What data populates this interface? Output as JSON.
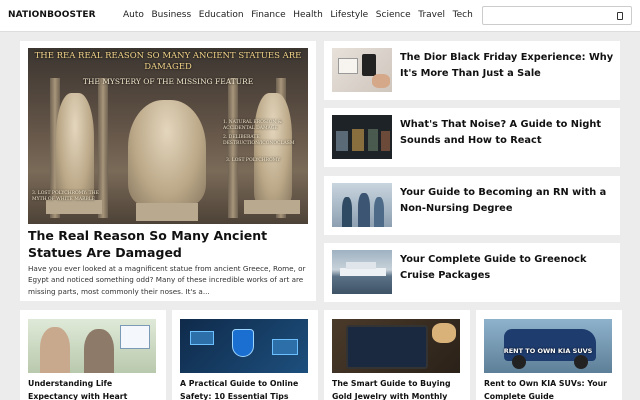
{
  "header": {
    "logo": "NATIONBOOSTER",
    "nav": [
      "Auto",
      "Business",
      "Education",
      "Finance",
      "Health",
      "Lifestyle",
      "Science",
      "Travel",
      "Tech"
    ],
    "search_placeholder": "",
    "search_icon": "search-icon"
  },
  "featured": {
    "image_title": "THE REA REAL REASON SO MANY ANCIENT STATUES ARE DAMAGED",
    "image_subtitle": "THE MYSTERY OF THE MISSING FEATURE",
    "image_labels": [
      "1. NATURAL EROSION & ACCIDENTAL DAMAGE",
      "2. DELIBERATE DESTRUCTION/ICONOCLASM",
      "3. LOST POLYCHROMY",
      "3. LOST POLYCHROMY: THE MYTH OF WHITE MARBLE"
    ],
    "title": "The Real Reason So Many Ancient Statues Are Damaged",
    "excerpt": "Have you ever looked at a magnificent statue from ancient Greece, Rome, or Egypt and noticed something odd? Many of these incredible works of art are missing parts, most commonly their noses. It's a..."
  },
  "side_articles": [
    {
      "title": "The Dior Black Friday Experience: Why It's More Than Just a Sale"
    },
    {
      "title": "What's That Noise? A Guide to Night Sounds and How to React"
    },
    {
      "title": "Your Guide to Becoming an RN with a Non-Nursing Degree"
    },
    {
      "title": "Your Complete Guide to Greenock Cruise Packages"
    }
  ],
  "bottom_articles": [
    {
      "title": "Understanding Life Expectancy with Heart"
    },
    {
      "title": "A Practical Guide to Online Safety: 10 Essential Tips"
    },
    {
      "title": "The Smart Guide to Buying Gold Jewelry with Monthly"
    },
    {
      "title": "Rent to Own KIA SUVs: Your Complete Guide",
      "image_text": "RENT TO OWN KIA SUVS"
    }
  ]
}
